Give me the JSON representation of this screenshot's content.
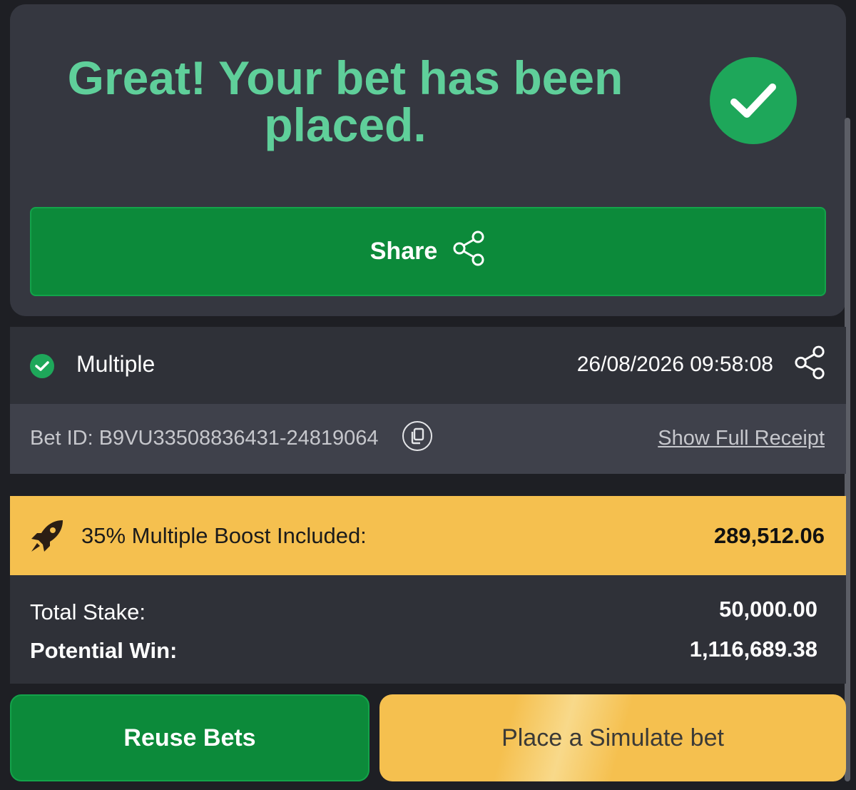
{
  "confirmation": {
    "title": "Great! Your bet has been placed.",
    "share_label": "Share",
    "check_icon": "check-icon",
    "share_icon": "share-icon",
    "accent_color": "#5fcf9a"
  },
  "bet": {
    "type": "Multiple",
    "datetime": "26/08/2026 09:58:08",
    "bet_id": "Bet ID: B9VU33508836431-24819064",
    "receipt_link": "Show Full Receipt"
  },
  "boost": {
    "label": "35% Multiple Boost Included:",
    "value": "289,512.06",
    "icon": "rocket-icon",
    "color": "#f5c04f"
  },
  "totals": {
    "stake_label": "Total Stake:",
    "stake_value": "50,000.00",
    "win_label": "Potential Win:",
    "win_value": "1,116,689.38"
  },
  "actions": {
    "reuse_label": "Reuse Bets",
    "simulate_label": "Place a Simulate bet",
    "green": "#0c8a3a",
    "yellow": "#f5c04f"
  }
}
